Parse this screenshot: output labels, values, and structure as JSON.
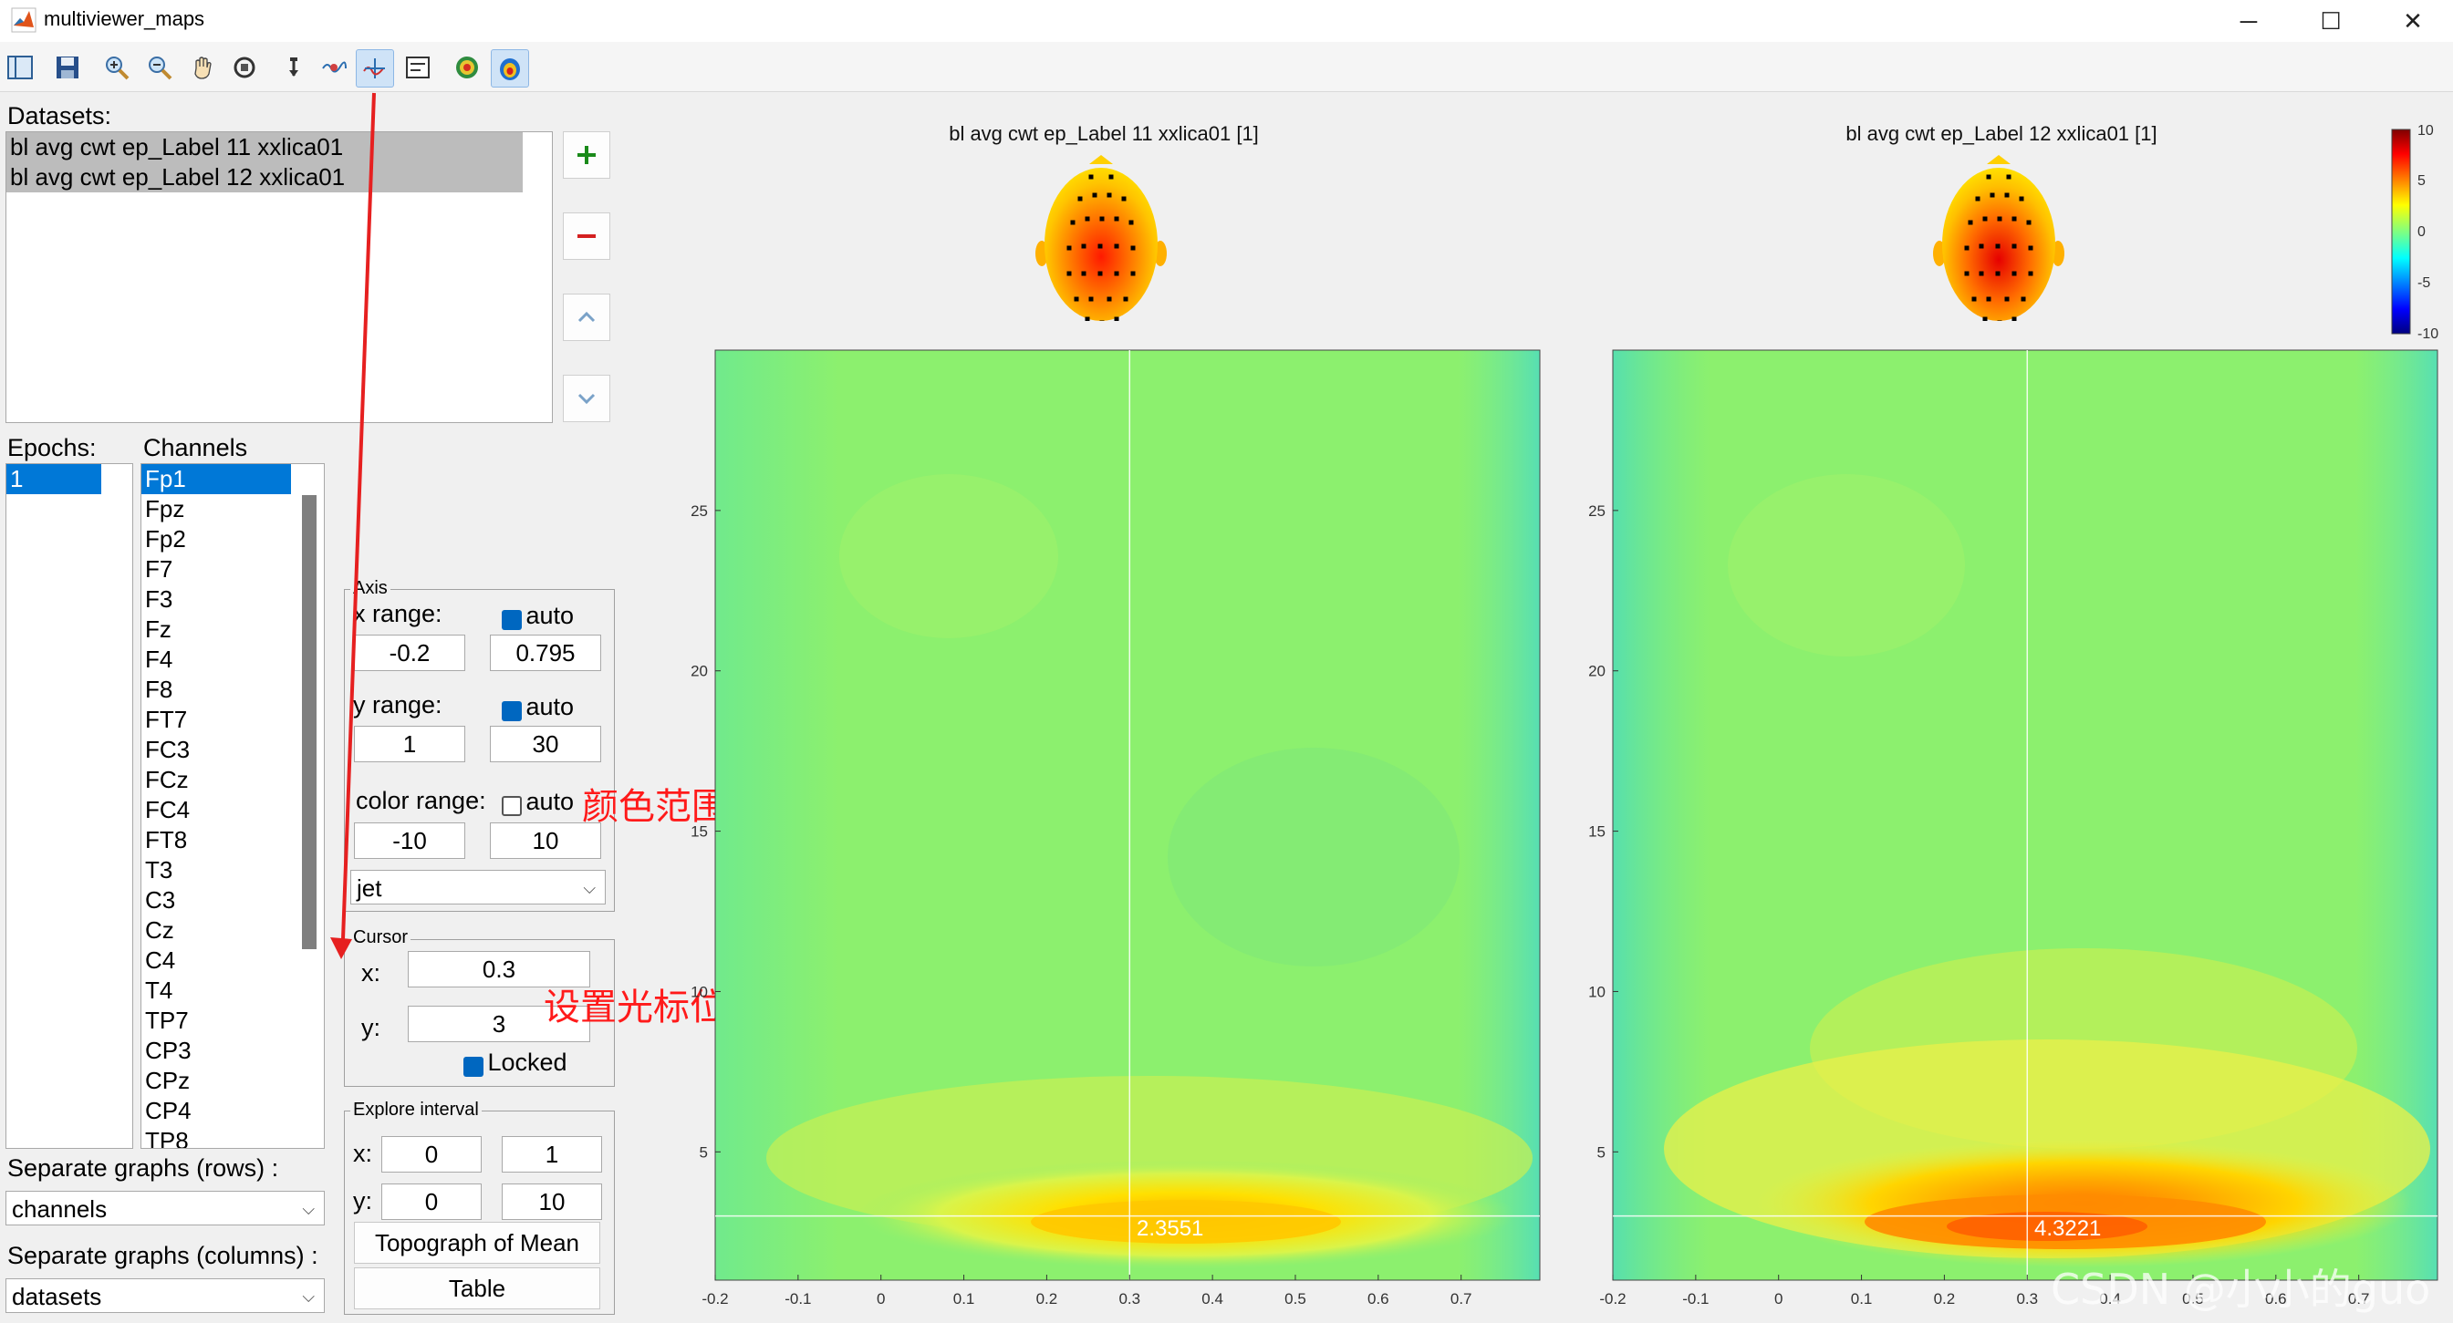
{
  "window": {
    "title": "multiviewer_maps",
    "minimize": "─",
    "maximize": "☐",
    "close": "✕"
  },
  "toolbar": {
    "icons": [
      "figure-icon",
      "save-icon",
      "zoom-in-icon",
      "zoom-out-icon",
      "pan-icon",
      "rotate-icon",
      "data-cursor-icon",
      "brush-icon",
      "link-icon",
      "legend-icon",
      "colorbar-icon",
      "topoplot-icon"
    ]
  },
  "datasets": {
    "label": "Datasets:",
    "items": [
      "bl avg cwt ep_Label 11 xxlica01",
      "bl avg cwt ep_Label 12 xxlica01"
    ]
  },
  "epochs": {
    "label": "Epochs:",
    "items": [
      "1"
    ]
  },
  "channels": {
    "label": "Channels",
    "items": [
      "Fp1",
      "Fpz",
      "Fp2",
      "F7",
      "F3",
      "Fz",
      "F4",
      "F8",
      "FT7",
      "FC3",
      "FCz",
      "FC4",
      "FT8",
      "T3",
      "C3",
      "Cz",
      "C4",
      "T4",
      "TP7",
      "CP3",
      "CPz",
      "CP4",
      "TP8"
    ]
  },
  "axis": {
    "group_title": "Axis",
    "x_range_label": "x range:",
    "x_min": "-0.2",
    "x_max": "0.795",
    "x_auto": "auto",
    "y_range_label": "y range:",
    "y_min": "1",
    "y_max": "30",
    "y_auto": "auto",
    "color_range_label": "color range:",
    "c_min": "-10",
    "c_max": "10",
    "c_auto": "auto",
    "colormap": "jet"
  },
  "cursor": {
    "group_title": "Cursor",
    "x_label": "x:",
    "x_value": "0.3",
    "y_label": "y:",
    "y_value": "3",
    "locked_label": "Locked"
  },
  "explore": {
    "group_title": "Explore interval",
    "x_label": "x:",
    "x_from": "0",
    "x_to": "1",
    "y_label": "y:",
    "y_from": "0",
    "y_to": "10",
    "topo_button": "Topograph of Mean",
    "table_button": "Table"
  },
  "separate_rows": {
    "label": "Separate graphs (rows) :",
    "value": "channels"
  },
  "separate_cols": {
    "label": "Separate graphs (columns) :",
    "value": "datasets"
  },
  "annotations": {
    "color_range": "颜色范围",
    "cursor_position": "设置光标位置"
  },
  "plots": [
    {
      "title": "bl avg cwt ep_Label 11 xxlica01 [1]",
      "cursor_value": "2.3551"
    },
    {
      "title": "bl avg cwt ep_Label 12 xxlica01 [1]",
      "cursor_value": "4.3221"
    }
  ],
  "plot_axes": {
    "x_ticks": [
      "-0.2",
      "-0.1",
      "0",
      "0.1",
      "0.2",
      "0.3",
      "0.4",
      "0.5",
      "0.6",
      "0.7"
    ],
    "y_ticks": [
      "25",
      "20",
      "15",
      "10",
      "5"
    ]
  },
  "colorbar": {
    "ticks": [
      "10",
      "5",
      "0",
      "-5",
      "-10"
    ]
  },
  "watermark": "CSDN @小小的guo"
}
